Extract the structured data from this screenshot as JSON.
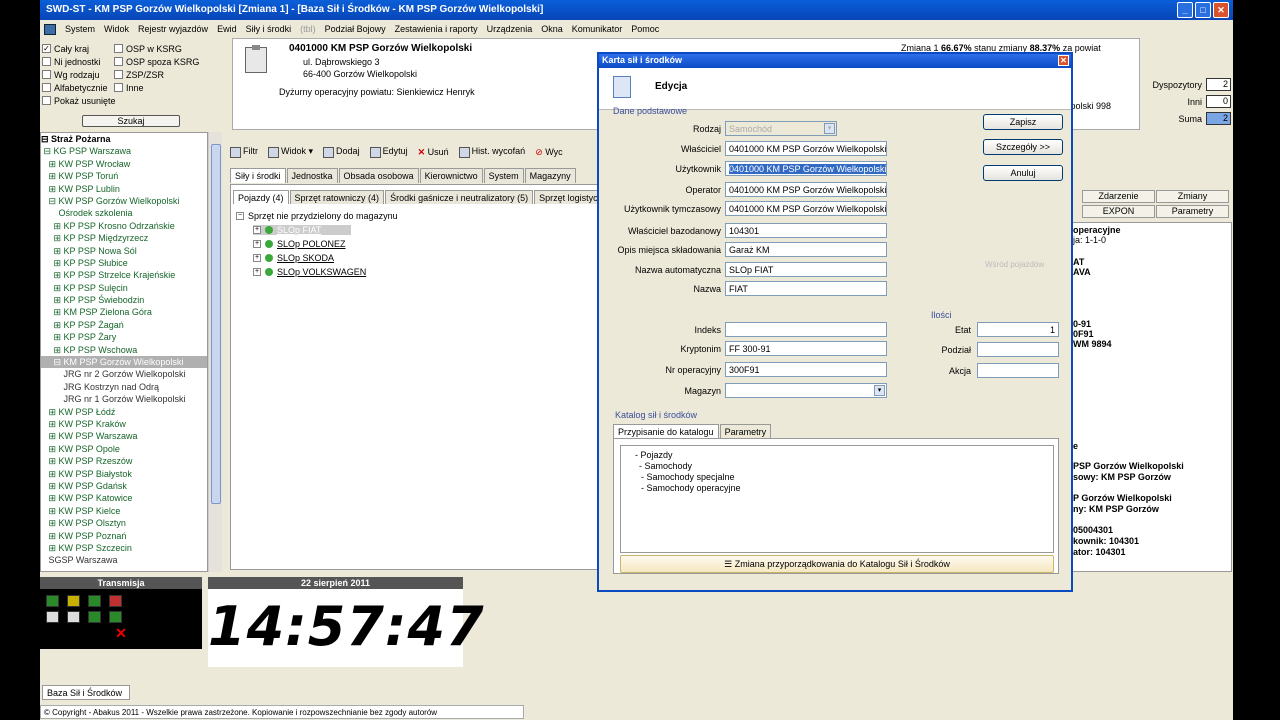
{
  "window": {
    "title": "SWD-ST - KM PSP Gorzów Wielkopolski [Zmiana 1] - [Baza Sił i Środków - KM PSP Gorzów Wielkopolski]"
  },
  "menu": [
    "System",
    "Widok",
    "Rejestr wyjazdów",
    "Ewid",
    "Siły i środki",
    "(tbl)",
    "Podział Bojowy",
    "Zestawienia i raporty",
    "Urządzenia",
    "Okna",
    "Komunikator",
    "Pomoc"
  ],
  "filters": {
    "col1": [
      {
        "label": "Cały kraj",
        "checked": true
      },
      {
        "label": "Ni jednostki",
        "checked": false
      },
      {
        "label": "Wg rodzaju",
        "checked": false
      },
      {
        "label": "Alfabetycznie",
        "checked": false
      },
      {
        "label": "Pokaż usunięte",
        "checked": false
      }
    ],
    "col2": [
      {
        "label": "OSP w KSRG",
        "checked": false
      },
      {
        "label": "OSP spoza KSRG",
        "checked": false
      },
      {
        "label": "ZSP/ZSR",
        "checked": false
      },
      {
        "label": "Inne",
        "checked": false
      }
    ],
    "search_label": "Szukaj"
  },
  "unit": {
    "name": "0401000 KM PSP Gorzów Wielkopolski",
    "street": "ul. Dąbrowskiego 3",
    "city": "66-400 Gorzów Wielkopolski",
    "duty": "Dyżurny operacyjny powiatu: Sienkiewicz Henryk",
    "shift_prefix": "Zmiana 1",
    "shift_pct1": "66.67%",
    "shift_mid": "stanu zmiany",
    "shift_pct2": "88.37%",
    "shift_suffix": "za powiat",
    "region_text": "copolski 998"
  },
  "counters": {
    "dysp_label": "Dyspozytory",
    "dysp": "2",
    "inni_label": "Inni",
    "inni": "0",
    "suma_label": "Suma",
    "suma": "2"
  },
  "tree": [
    {
      "label": "⊟ Straż Pożarna",
      "type": "root"
    },
    {
      "label": " ⊟ KG PSP Warszawa",
      "type": "n"
    },
    {
      "label": "   ⊞ KW PSP Wrocław",
      "type": "n"
    },
    {
      "label": "   ⊞ KW PSP Toruń",
      "type": "n"
    },
    {
      "label": "   ⊞ KW PSP Lublin",
      "type": "n"
    },
    {
      "label": "   ⊟ KW PSP Gorzów Wielkopolski",
      "type": "n"
    },
    {
      "label": "       Ośrodek szkolenia",
      "type": "n"
    },
    {
      "label": "     ⊞ KP PSP Krosno Odrzańskie",
      "type": "n"
    },
    {
      "label": "     ⊞ KP PSP Międzyrzecz",
      "type": "n"
    },
    {
      "label": "     ⊞ KP PSP Nowa Sól",
      "type": "n"
    },
    {
      "label": "     ⊞ KP PSP Słubice",
      "type": "n"
    },
    {
      "label": "     ⊞ KP PSP Strzelce Krajeńskie",
      "type": "n"
    },
    {
      "label": "     ⊞ KP PSP Sulęcin",
      "type": "n"
    },
    {
      "label": "     ⊞ KP PSP Świebodzin",
      "type": "n"
    },
    {
      "label": "     ⊞ KM PSP Zielona Góra",
      "type": "n"
    },
    {
      "label": "     ⊞ KP PSP Żagań",
      "type": "n"
    },
    {
      "label": "     ⊞ KP PSP Żary",
      "type": "n"
    },
    {
      "label": "     ⊞ KP PSP Wschowa",
      "type": "n"
    },
    {
      "label": "     ⊟ KM PSP Gorzów Wielkopolski",
      "type": "sel"
    },
    {
      "label": "         JRG nr 2 Gorzów Wielkopolski",
      "type": "p"
    },
    {
      "label": "         JRG Kostrzyn nad Odrą",
      "type": "p"
    },
    {
      "label": "         JRG nr 1 Gorzów Wielkopolski",
      "type": "p"
    },
    {
      "label": "   ⊞ KW PSP Łódź",
      "type": "n"
    },
    {
      "label": "   ⊞ KW PSP Kraków",
      "type": "n"
    },
    {
      "label": "   ⊞ KW PSP Warszawa",
      "type": "n"
    },
    {
      "label": "   ⊞ KW PSP Opole",
      "type": "n"
    },
    {
      "label": "   ⊞ KW PSP Rzeszów",
      "type": "n"
    },
    {
      "label": "   ⊞ KW PSP Białystok",
      "type": "n"
    },
    {
      "label": "   ⊞ KW PSP Gdańsk",
      "type": "n"
    },
    {
      "label": "   ⊞ KW PSP Katowice",
      "type": "n"
    },
    {
      "label": "   ⊞ KW PSP Kielce",
      "type": "n"
    },
    {
      "label": "   ⊞ KW PSP Olsztyn",
      "type": "n"
    },
    {
      "label": "   ⊞ KW PSP Poznań",
      "type": "n"
    },
    {
      "label": "   ⊞ KW PSP Szczecin",
      "type": "n"
    },
    {
      "label": "   SGSP Warszawa",
      "type": "p"
    }
  ],
  "toolbar": [
    "Filtr",
    "Widok",
    "Dodaj",
    "Edytuj",
    "Usuń",
    "Hist. wycofań",
    "Wyc"
  ],
  "tabs": [
    "Siły i środki",
    "Jednostka",
    "Obsada osobowa",
    "Kierownictwo",
    "System",
    "Magazyny"
  ],
  "subtabs": [
    "Pojazdy (4)",
    "Sprzęt ratowniczy (4)",
    "Środki gaśnicze i neutralizatory (5)",
    "Sprzęt logistyczny"
  ],
  "vehicle_list": {
    "group": "Sprzęt nie przydzielony do magazynu",
    "items": [
      "SLOp FIAT",
      "SLOp POLONEZ",
      "SLOp SKODA",
      "SLOp VOLKSWAGEN"
    ]
  },
  "transmisja": {
    "title": "Transmisja"
  },
  "clock": {
    "date": "22 sierpień 2011",
    "time": "14:57:47"
  },
  "bottom_tab": "Baza Sił i Środków",
  "status": "© Copyright - Abakus 2011 - Wszelkie prawa zastrzeżone. Kopiowanie i rozpowszechnianie bez zgody autorów",
  "right_panel": {
    "tabs": [
      "Zdarzenie",
      "Zmiany",
      "EXPON",
      "Parametry"
    ],
    "lines": [
      {
        "t": "operacyjne",
        "b": true
      },
      {
        "t": "ja: 1-1-0",
        "b": false
      },
      {
        "t": "AT",
        "b": true
      },
      {
        "t": "AVA",
        "b": true
      },
      {
        "t": "0-91",
        "b": true
      },
      {
        "t": "0F91",
        "b": true
      },
      {
        "t": "WM 9894",
        "b": true
      },
      {
        "t": "e",
        "b": true
      },
      {
        "t": "PSP Gorzów Wielkopolski",
        "b": true
      },
      {
        "t": "sowy: KM PSP Gorzów",
        "b": true
      },
      {
        "t": "P Gorzów Wielkopolski",
        "b": true
      },
      {
        "t": "ny: KM PSP Gorzów",
        "b": true
      },
      {
        "t": "05004301",
        "b": true
      },
      {
        "t": "kownik: 104301",
        "b": true
      },
      {
        "t": "ator: 104301",
        "b": true
      }
    ]
  },
  "dialog": {
    "title": "Karta sił i środków",
    "header": "Edycja",
    "section_basic": "Dane podstawowe",
    "fields": {
      "rodzaj": {
        "label": "Rodzaj",
        "value": "Samochód"
      },
      "wlasciciel": {
        "label": "Właściciel",
        "value": "0401000 KM PSP Gorzów Wielkopolski"
      },
      "uzytkownik": {
        "label": "Użytkownik",
        "value": "0401000 KM PSP Gorzów Wielkopolski"
      },
      "operator": {
        "label": "Operator",
        "value": "0401000 KM PSP Gorzów Wielkopolski"
      },
      "uzyt_tymczasowy": {
        "label": "Użytkownik tymczasowy",
        "value": "0401000 KM PSP Gorzów Wielkopolski"
      },
      "wlasc_bazodanowy": {
        "label": "Właściciel bazodanowy",
        "value": "104301"
      },
      "opis_miejsca": {
        "label": "Opis miejsca składowania",
        "value": "Garaż KM"
      },
      "nazwa_auto": {
        "label": "Nazwa automatyczna",
        "value": "SLOp FIAT"
      },
      "nazwa": {
        "label": "Nazwa",
        "value": "FIAT"
      },
      "indeks": {
        "label": "Indeks",
        "value": ""
      },
      "kryptonim": {
        "label": "Kryptonim",
        "value": "FF 300-91"
      },
      "nr_operacyjny": {
        "label": "Nr operacyjny",
        "value": "300F91"
      },
      "magazyn": {
        "label": "Magazyn",
        "value": ""
      }
    },
    "ilosci": {
      "title": "Ilości",
      "etat_label": "Etat",
      "etat": "1",
      "podzial_label": "Podział",
      "podzial": "",
      "akcja_label": "Akcja",
      "akcja": ""
    },
    "side_label": "Wśród pojazdów",
    "buttons": {
      "save": "Zapisz",
      "details": "Szczegóły >>",
      "cancel": "Anuluj"
    },
    "catalog": {
      "section": "Katalog sił i środków",
      "tabs": [
        "Przypisanie do katalogu",
        "Parametry"
      ],
      "lines": [
        "- Pojazdy",
        "- Samochody",
        "- Samochody specjalne",
        "- Samochody operacyjne"
      ],
      "button": "Zmiana przyporządkowania do Katalogu Sił i Środków"
    }
  }
}
